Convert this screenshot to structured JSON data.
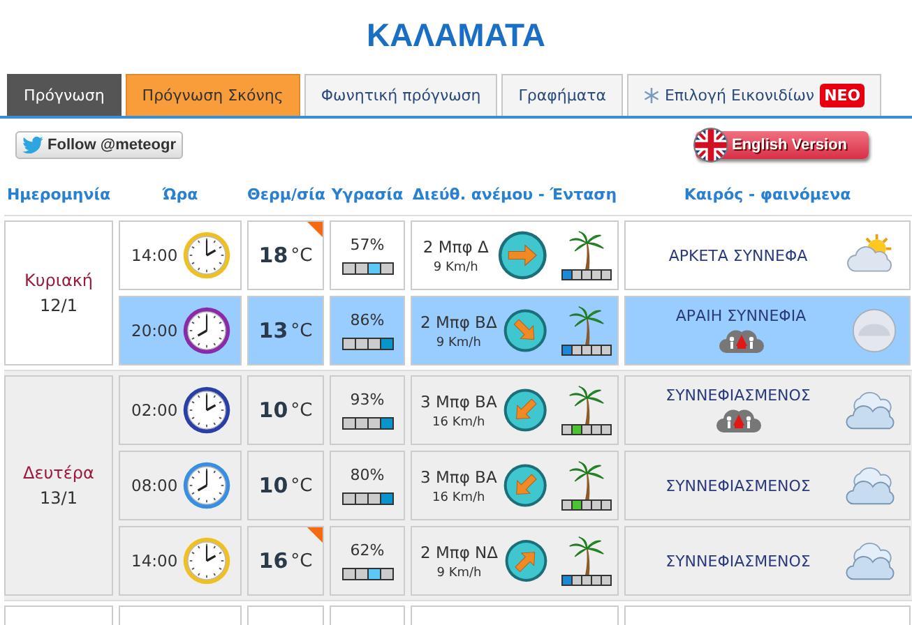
{
  "title": "ΚΑΛΑΜΑΤΑ",
  "tabs": [
    {
      "label": "Πρόγνωση",
      "selected": true,
      "kind": "normal"
    },
    {
      "label": "Πρόγνωση Σκόνης",
      "selected": false,
      "kind": "highlight"
    },
    {
      "label": "Φωνητική πρόγνωση",
      "selected": false,
      "kind": "normal"
    },
    {
      "label": "Γραφήματα",
      "selected": false,
      "kind": "normal"
    },
    {
      "label": "Επιλογή Εικονιδίων",
      "selected": false,
      "kind": "icon",
      "badge": "ΝΕΟ"
    }
  ],
  "follow_button": "Follow @meteogr",
  "language_button": "English Version",
  "columns": [
    "Ημερομηνία",
    "Ώρα",
    "Θερμ/σία",
    "Υγρασία",
    "Διεύθ. ανέμου - Ένταση",
    "Καιρός - φαινόμενα"
  ],
  "days": [
    {
      "day": "Κυριακή",
      "date": "12/1",
      "rows": [
        {
          "time": "14:00",
          "color": "#f0c020",
          "temp": "18",
          "unit": "°C",
          "max": true,
          "humidity": "57%",
          "humidity_meter": {
            "kind": "moderate"
          },
          "wind": "2 Μπφ Δ",
          "speed": "9 Km/h",
          "compass": {
            "kind": "east"
          },
          "wind_meter": {
            "kind": "light"
          },
          "weather": "ΑΡΚΕΤΑ ΣΥΝΝΕΦΑ",
          "alert": false,
          "kind": "sun_cloud",
          "selected": false
        },
        {
          "time": "20:00",
          "color": "#8a2aa8",
          "temp": "13",
          "unit": "°C",
          "max": false,
          "humidity": "86%",
          "humidity_meter": {
            "kind": "high"
          },
          "wind": "2 Μπφ ΒΔ",
          "speed": "9 Km/h",
          "compass": {
            "kind": "southeast"
          },
          "wind_meter": {
            "kind": "light"
          },
          "weather": "ΑΡΑΙΗ ΣΥΝΝΕΦΙΑ",
          "alert": true,
          "kind": "moon",
          "selected": true
        }
      ]
    },
    {
      "day": "Δευτέρα",
      "date": "13/1",
      "rows": [
        {
          "time": "02:00",
          "color": "#2a3ea8",
          "temp": "10",
          "unit": "°C",
          "max": false,
          "humidity": "93%",
          "humidity_meter": {
            "kind": "high"
          },
          "wind": "3 Μπφ ΒΑ",
          "speed": "16 Km/h",
          "compass": {
            "kind": "southwest"
          },
          "wind_meter": {
            "kind": "gentle"
          },
          "weather": "ΣΥΝΝΕΦΙΑΣΜΕΝΟΣ",
          "alert": true,
          "kind": "clouds",
          "selected": false
        },
        {
          "time": "08:00",
          "color": "#3a8ee0",
          "temp": "10",
          "unit": "°C",
          "max": false,
          "humidity": "80%",
          "humidity_meter": {
            "kind": "high"
          },
          "wind": "3 Μπφ ΒΑ",
          "speed": "16 Km/h",
          "compass": {
            "kind": "southwest"
          },
          "wind_meter": {
            "kind": "gentle"
          },
          "weather": "ΣΥΝΝΕΦΙΑΣΜΕΝΟΣ",
          "alert": false,
          "kind": "clouds",
          "selected": false
        },
        {
          "time": "14:00",
          "color": "#f0c020",
          "temp": "16",
          "unit": "°C",
          "max": true,
          "humidity": "62%",
          "humidity_meter": {
            "kind": "moderate"
          },
          "wind": "2 Μπφ ΝΔ",
          "speed": "9 Km/h",
          "compass": {
            "kind": "northeast"
          },
          "wind_meter": {
            "kind": "light"
          },
          "weather": "ΣΥΝΝΕΦΙΑΣΜΕΝΟΣ",
          "alert": false,
          "kind": "clouds",
          "selected": false
        }
      ]
    }
  ]
}
